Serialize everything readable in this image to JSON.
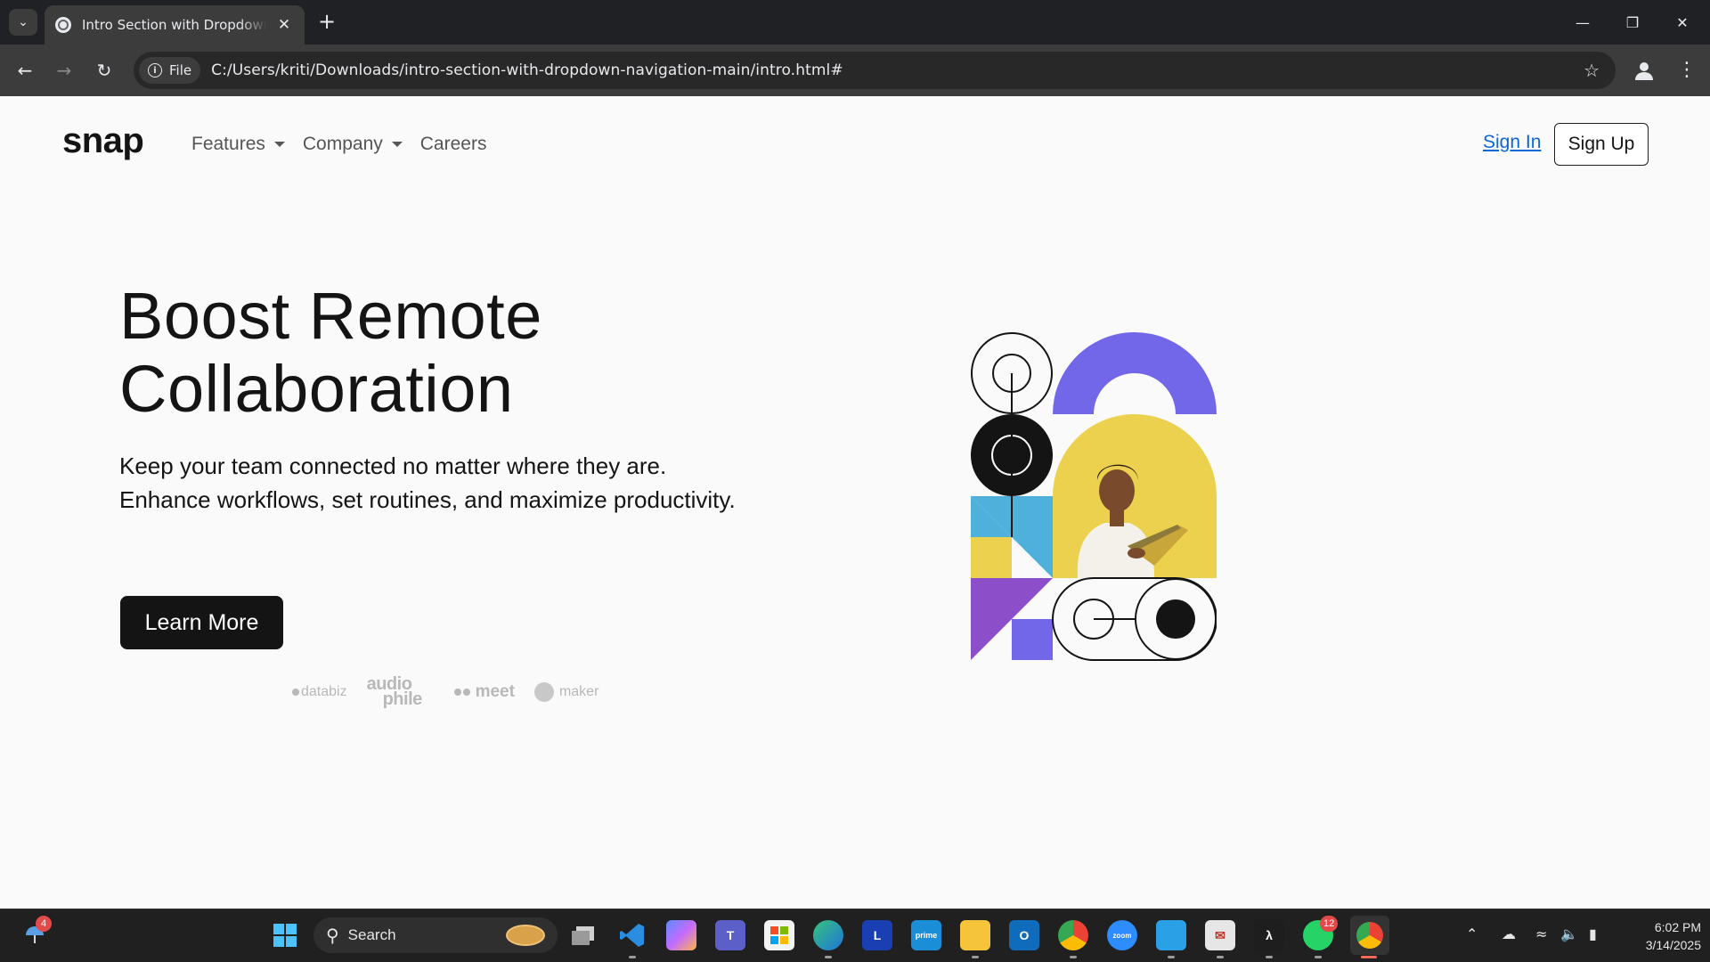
{
  "browser": {
    "tab_title": "Intro Section with Dropdown Navigation",
    "new_tab": "+",
    "site_chip": "File",
    "url": "C:/Users/kriti/Downloads/intro-section-with-dropdown-navigation-main/intro.html#"
  },
  "site": {
    "logo": "snap",
    "nav": [
      {
        "label": "Features",
        "dropdown": true
      },
      {
        "label": "Company",
        "dropdown": true
      },
      {
        "label": "Careers",
        "dropdown": false
      }
    ],
    "sign_in": "Sign In",
    "sign_up": "Sign Up"
  },
  "hero": {
    "title_line1": "Boost Remote",
    "title_line2": "Collaboration",
    "description": "Keep your team connected no matter where they are. Enhance workflows, set routines, and maximize productivity.",
    "cta": "Learn More",
    "clients": [
      "databiz",
      "audio",
      "phile",
      "meet",
      "maker"
    ]
  },
  "colors": {
    "accent_purple": "#7267e9",
    "accent_yellow": "#ebd14d",
    "accent_blue": "#4fb0dc",
    "accent_violet": "#8c4fc9",
    "ink": "#141414",
    "link": "#0b66d6"
  },
  "taskbar": {
    "search_placeholder": "Search",
    "weather_badge": "4",
    "whatsapp_badge": "12",
    "time": "6:02 PM",
    "date": "3/14/2025"
  }
}
